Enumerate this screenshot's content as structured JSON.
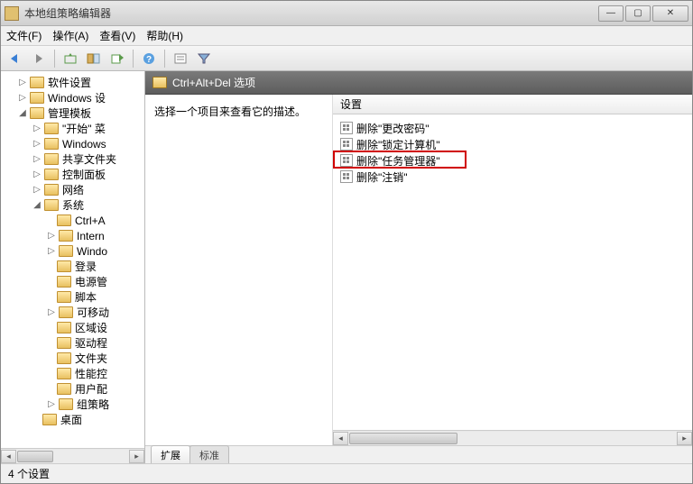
{
  "window": {
    "title": "本地组策略编辑器"
  },
  "menu": {
    "file": "文件(F)",
    "action": "操作(A)",
    "view": "查看(V)",
    "help": "帮助(H)"
  },
  "tree": {
    "items": [
      {
        "indent": 1,
        "exp": "▷",
        "label": "软件设置"
      },
      {
        "indent": 1,
        "exp": "▷",
        "label": "Windows 设"
      },
      {
        "indent": 1,
        "exp": "◢",
        "label": "管理模板"
      },
      {
        "indent": 2,
        "exp": "▷",
        "label": "\"开始\" 菜"
      },
      {
        "indent": 2,
        "exp": "▷",
        "label": "Windows"
      },
      {
        "indent": 2,
        "exp": "▷",
        "label": "共享文件夹"
      },
      {
        "indent": 2,
        "exp": "▷",
        "label": "控制面板"
      },
      {
        "indent": 2,
        "exp": "▷",
        "label": "网络"
      },
      {
        "indent": 2,
        "exp": "◢",
        "label": "系统"
      },
      {
        "indent": 3,
        "exp": "",
        "label": "Ctrl+A"
      },
      {
        "indent": 3,
        "exp": "▷",
        "label": "Intern"
      },
      {
        "indent": 3,
        "exp": "▷",
        "label": "Windo"
      },
      {
        "indent": 3,
        "exp": "",
        "label": "登录"
      },
      {
        "indent": 3,
        "exp": "",
        "label": "电源管"
      },
      {
        "indent": 3,
        "exp": "",
        "label": "脚本"
      },
      {
        "indent": 3,
        "exp": "▷",
        "label": "可移动"
      },
      {
        "indent": 3,
        "exp": "",
        "label": "区域设"
      },
      {
        "indent": 3,
        "exp": "",
        "label": "驱动程"
      },
      {
        "indent": 3,
        "exp": "",
        "label": "文件夹"
      },
      {
        "indent": 3,
        "exp": "",
        "label": "性能控"
      },
      {
        "indent": 3,
        "exp": "",
        "label": "用户配"
      },
      {
        "indent": 3,
        "exp": "▷",
        "label": "组策略"
      },
      {
        "indent": 2,
        "exp": "",
        "label": "桌面"
      }
    ]
  },
  "path": {
    "title": "Ctrl+Alt+Del 选项"
  },
  "desc": {
    "prompt": "选择一个项目来查看它的描述。"
  },
  "list": {
    "header": "设置",
    "items": [
      "删除\"更改密码\"",
      "删除\"锁定计算机\"",
      "删除\"任务管理器\"",
      "删除\"注销\""
    ],
    "highlighted_index": 2
  },
  "tabs": {
    "extended": "扩展",
    "standard": "标准"
  },
  "status": {
    "text": "4 个设置"
  }
}
